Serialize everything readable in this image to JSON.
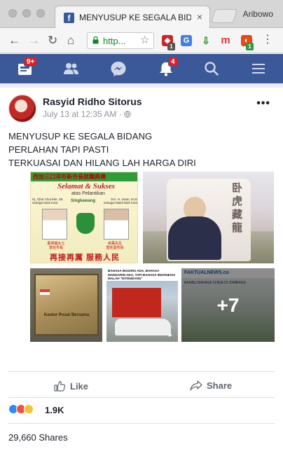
{
  "browser": {
    "tab_title": "MENYUSUP KE SEGALA BIDANG",
    "tab_close": "×",
    "profile_name": "Aribowo",
    "url_display": "http...",
    "extension_badges": [
      "1",
      "1"
    ],
    "accent_secure": "#0a8a2a"
  },
  "facebook": {
    "brand_color": "#3b5998",
    "nav_icons": [
      "feed-icon",
      "friends-icon",
      "messenger-icon",
      "notifications-icon",
      "search-icon",
      "menu-icon"
    ],
    "feed_badge": "9+",
    "notifications_badge": "4"
  },
  "post": {
    "author": "Rasyid Ridho Sitorus",
    "timestamp": "July 13 at 12:35 AM",
    "privacy_glyph": "·",
    "lines": [
      "MENYUSUP KE SEGALA BIDANG",
      "PERLAHAN TAPI PASTI",
      "TERKUASAI DAN HILANG LAH HARGA DIRI"
    ],
    "banner": {
      "top_cn": "西加三口洋市新市長就職典禮",
      "greeting": "Selamat & Sukses",
      "sub": "atas Pelantikan",
      "city": "Singkawang",
      "left_name": "Hj. Tjhai Chui Mie, SE",
      "left_role": "sebagai Wali Kota",
      "right_name": "Drs. H. Irwan, M.Si",
      "right_role": "sebagai Wakil Wali Kota",
      "left_cn_name": "蔡翠媚女士",
      "left_cn_role": "當任市長",
      "right_cn_name": "依萬先生",
      "right_cn_role": "當任副市長",
      "motto": "再接再厲 服務人民"
    },
    "sign_photo_text": "卧虎藏龍",
    "thumb1_text": "Kantor Pusat Bersama",
    "thumb2_text": "BAHASA INGGRIS ADA, BAHASA MANDARIN ADA, TAPI BAHASA INDONESIA MALAH \"DITENDANG\"",
    "thumb3_site": "FAKTUALNEWS.co",
    "thumb3_headline": "BAMBU BAHASA CHINA DI JOMBANG",
    "more_photos": "+7",
    "like_label": "Like",
    "share_label": "Share",
    "reaction_count": "1.9K",
    "shares_text": "29,660 Shares"
  }
}
